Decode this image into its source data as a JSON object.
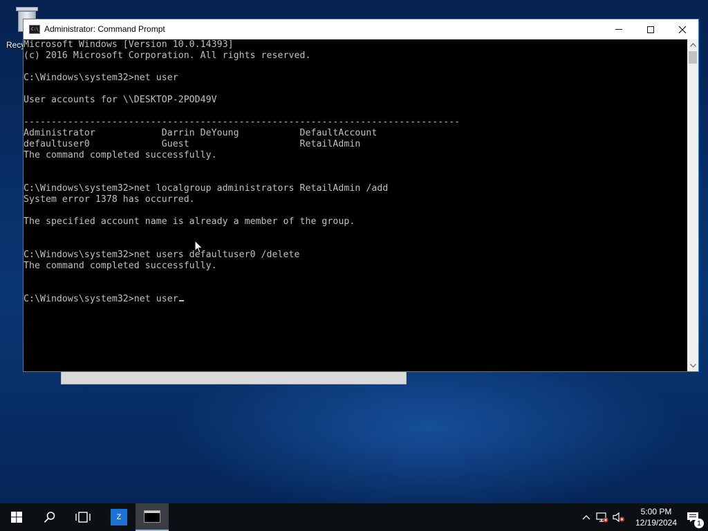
{
  "desktop": {
    "recycle_bin_label": "Recyc"
  },
  "window": {
    "title": "Administrator: Command Prompt",
    "icon_text": "C:\\_"
  },
  "console": {
    "lines": [
      "Microsoft Windows [Version 10.0.14393]",
      "(c) 2016 Microsoft Corporation. All rights reserved.",
      "",
      "C:\\Windows\\system32>net user",
      "",
      "User accounts for \\\\DESKTOP-2POD49V",
      "",
      "-------------------------------------------------------------------------------",
      "Administrator            Darrin DeYoung           DefaultAccount",
      "defaultuser0             Guest                    RetailAdmin",
      "The command completed successfully.",
      "",
      "",
      "C:\\Windows\\system32>net localgroup administrators RetailAdmin /add",
      "System error 1378 has occurred.",
      "",
      "The specified account name is already a member of the group.",
      "",
      "",
      "C:\\Windows\\system32>net users defaultuser0 /delete",
      "The command completed successfully.",
      "",
      "",
      "C:\\Windows\\system32>net user"
    ]
  },
  "taskbar": {
    "app1_glyph": "Z",
    "time": "5:00 PM",
    "date": "12/19/2024",
    "notification_count": "1"
  },
  "colors": {
    "console_bg": "#000000",
    "console_fg": "#c0c0c0",
    "window_border": "#1c8ad8",
    "taskbar_bg": "#0c0f14"
  }
}
